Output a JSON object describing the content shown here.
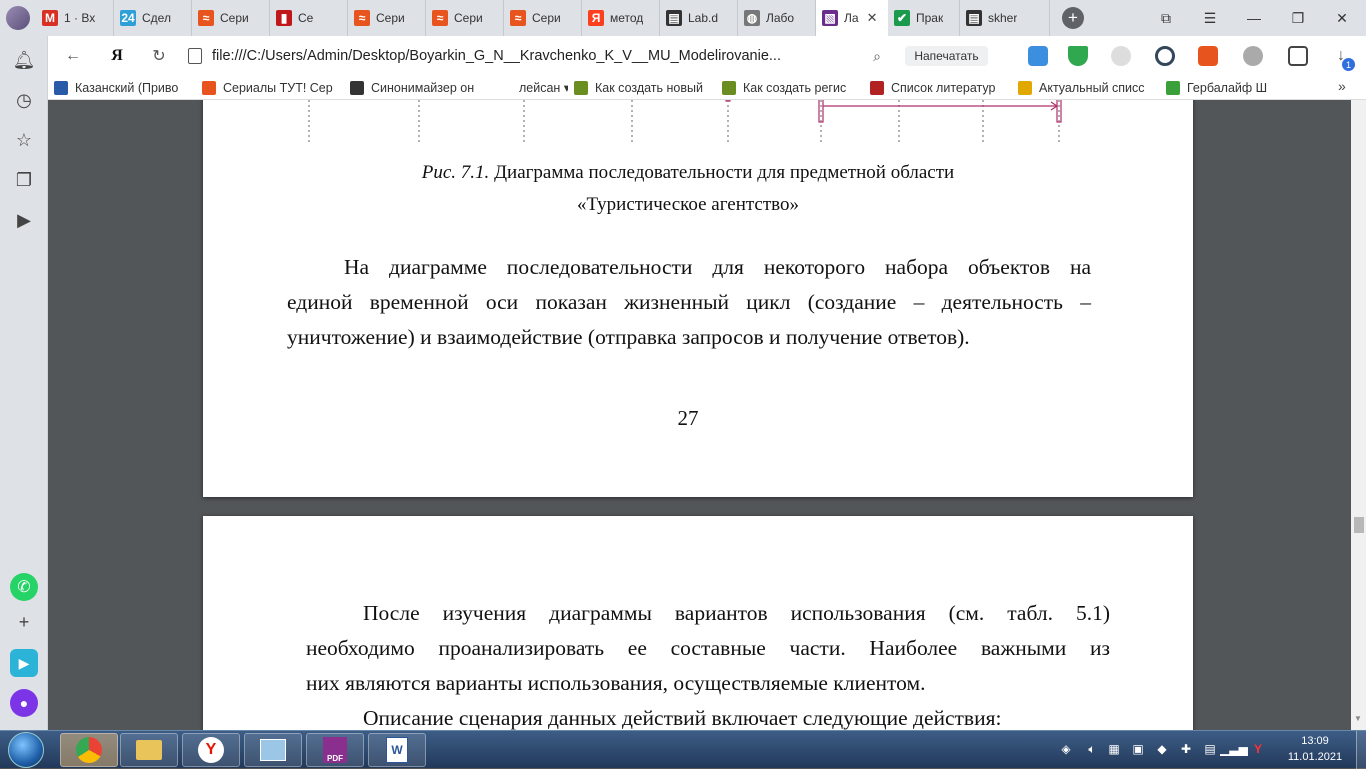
{
  "tabs": [
    {
      "label": "1 · Вх",
      "fav": "M",
      "color": "#d93025"
    },
    {
      "label": "Сдел",
      "fav": "24",
      "color": "#2f9fd8"
    },
    {
      "label": "Сери",
      "fav": "≈",
      "color": "#e8541e"
    },
    {
      "label": "Се",
      "fav": "▮",
      "color": "#c0171b"
    },
    {
      "label": "Сери",
      "fav": "≈",
      "color": "#e8541e"
    },
    {
      "label": "Сери",
      "fav": "≈",
      "color": "#e8541e"
    },
    {
      "label": "Сери",
      "fav": "≈",
      "color": "#e8541e"
    },
    {
      "label": "метод",
      "fav": "Я",
      "color": "#fc3f1d"
    },
    {
      "label": "Lab.d",
      "fav": "▤",
      "color": "#333333"
    },
    {
      "label": "Лабо",
      "fav": "◍",
      "color": "#777777"
    },
    {
      "label": "Ла",
      "fav": "▧",
      "color": "#6b2d8b"
    },
    {
      "label": "Прак",
      "fav": "✔",
      "color": "#1a9a4b"
    },
    {
      "label": "skher",
      "fav": "▤",
      "color": "#333333"
    }
  ],
  "address": {
    "url": "file:///C:/Users/Admin/Desktop/Boyarkin_G_N__Kravchenko_K_V__MU_Modelirovanie...",
    "print_label": "Напечатать",
    "downloads_badge": "1"
  },
  "bookmarks": [
    {
      "label": "Казанский (Приво",
      "color": "#2a5ba8"
    },
    {
      "label": "Сериалы ТУТ! Сер",
      "color": "#e8541e"
    },
    {
      "label": "Синонимайзер он",
      "color": "#333333"
    },
    {
      "label": "лейсан ▾",
      "color": "#ffffff"
    },
    {
      "label": "Как создать новый",
      "color": "#6b8e23"
    },
    {
      "label": "Как создать регис",
      "color": "#6b8e23"
    },
    {
      "label": "Список литератур",
      "color": "#b22222"
    },
    {
      "label": "Актуальный списс",
      "color": "#e0a800"
    },
    {
      "label": "Гербалайф Ш",
      "color": "#3aa13a"
    }
  ],
  "document": {
    "figure_caption_italic": "Рис. 7.1.",
    "figure_caption_rest": "Диаграмма последовательности для предметной области",
    "figure_caption_line2": "«Туристическое агентство»",
    "para1": [
      "На диаграмме последовательности для некоторого набора объектов на",
      "единой временной оси показан жизненный цикл (создание – деятельность –",
      "уничтожение) и взаимодействие (отправка запросов и получение ответов)."
    ],
    "page_number": "27",
    "para2": [
      "После изучения диаграммы вариантов использования (см. табл. 5.1)",
      "необходимо проанализировать ее составные части. Наиболее важными из",
      "них являются варианты использования, осуществляемые клиентом."
    ],
    "para3_first_line": "Описание сценария данных действий включает следующие действия:"
  },
  "taskbar": {
    "time": "13:09",
    "date": "11.01.2021",
    "apps": [
      "chrome",
      "explorer",
      "yandex-browser",
      "control-panel",
      "pdf-reader",
      "word"
    ]
  }
}
